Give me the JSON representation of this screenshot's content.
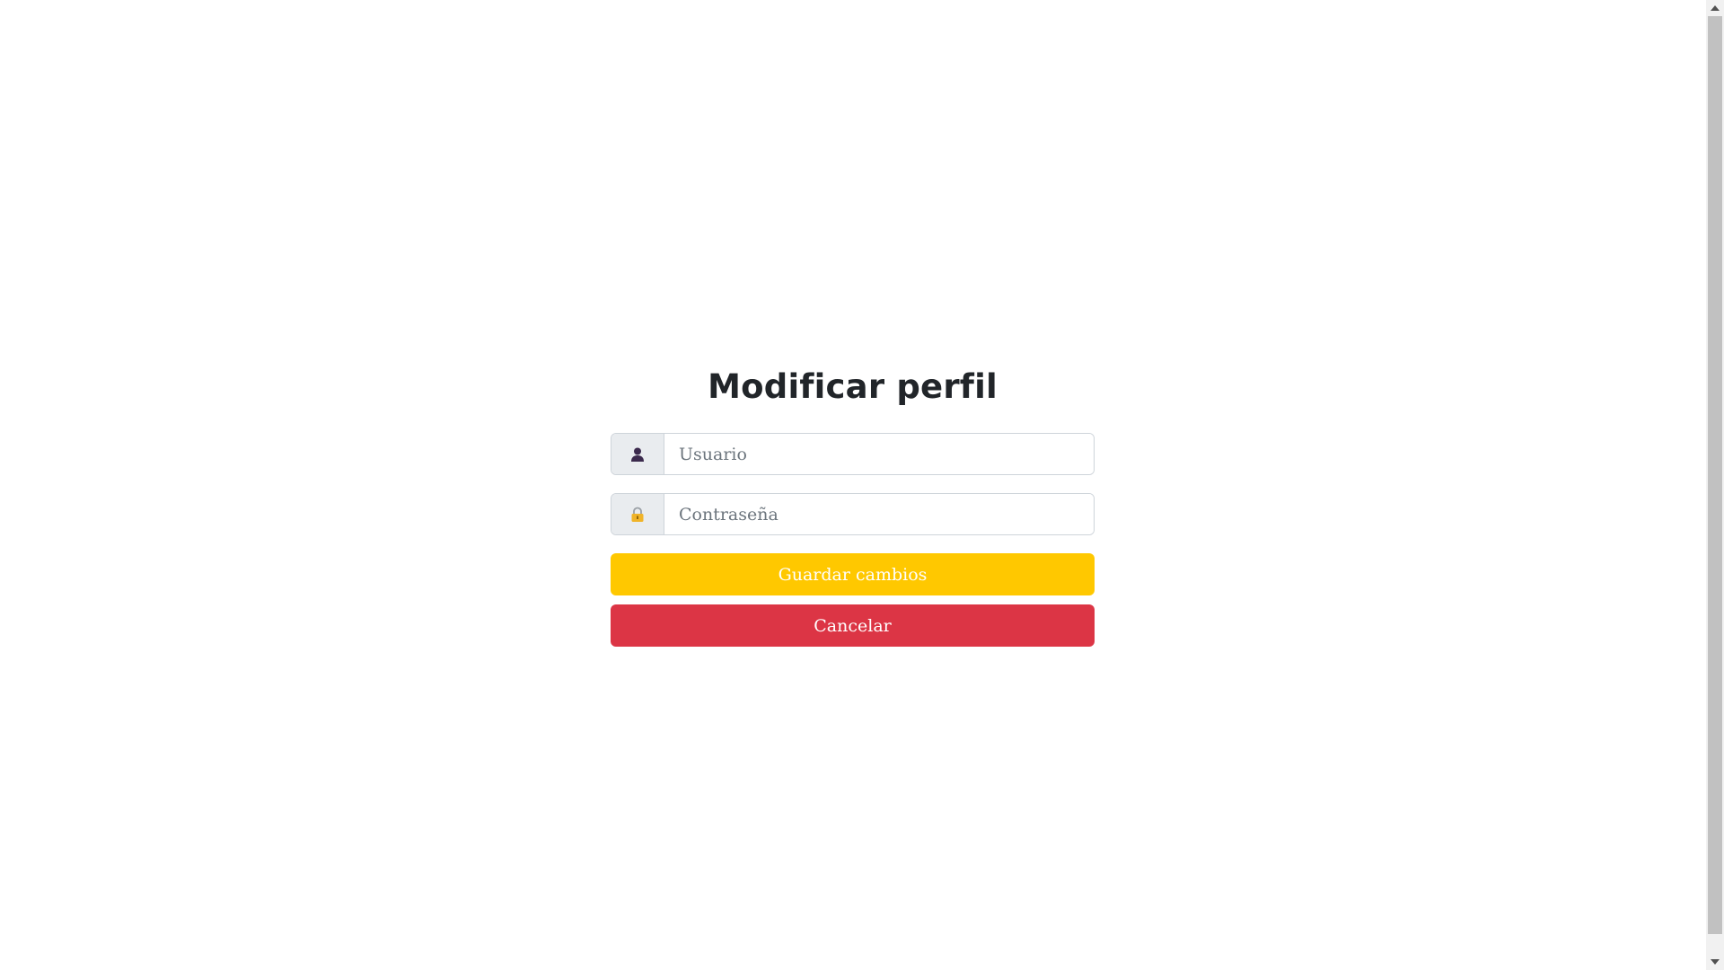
{
  "form": {
    "title": "Modificar perfil",
    "username": {
      "icon": "user-icon",
      "placeholder": "Usuario",
      "value": ""
    },
    "password": {
      "icon": "lock-icon",
      "placeholder": "Contraseña",
      "value": ""
    },
    "save_label": "Guardar cambios",
    "cancel_label": "Cancelar"
  },
  "colors": {
    "save_button": "#ffc800",
    "cancel_button": "#dc3545",
    "title_text": "#212529",
    "addon_background": "#e9ecef",
    "user_icon": "#3b2a4d",
    "lock_icon": "#f0b429"
  },
  "scrollbar": {
    "up_icon": "scroll-up-arrow-icon",
    "down_icon": "scroll-down-arrow-icon"
  }
}
